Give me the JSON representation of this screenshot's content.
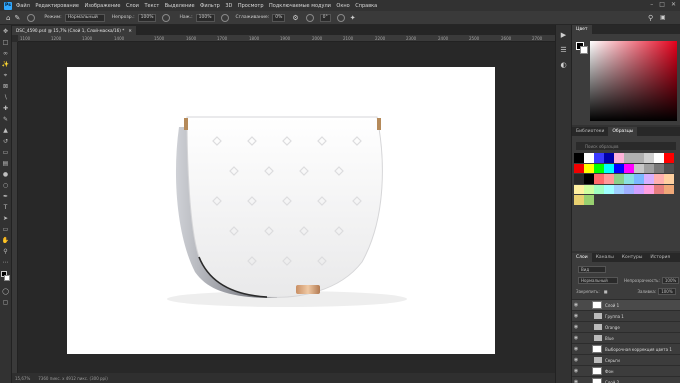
{
  "app": {
    "logo": "Ps"
  },
  "menu": [
    "Файл",
    "Редактирование",
    "Изображение",
    "Слои",
    "Текст",
    "Выделение",
    "Фильтр",
    "3D",
    "Просмотр",
    "Подключаемые модули",
    "Окно",
    "Справка"
  ],
  "options": {
    "mode_label": "Режим:",
    "mode_value": "Нормальный",
    "opacity_label": "Непрозр.:",
    "opacity_value": "100%",
    "flow_label": "Наж.:",
    "flow_value": "100%",
    "smooth_label": "Сглаживание:",
    "smooth_value": "0%",
    "angle_value": "0°"
  },
  "document": {
    "tab_title": "DSC_4590.psd @ 15,7% (Слой 1, Слой-маска/16) *"
  },
  "rulers": {
    "top": [
      "1100",
      "1200",
      "1300",
      "1400",
      "1500",
      "1600",
      "1700",
      "1800",
      "1900",
      "2000",
      "2100",
      "2200",
      "2300",
      "2400",
      "2500",
      "2600",
      "2700"
    ]
  },
  "status": {
    "zoom": "15,67%",
    "size": "7360 пикс. x 4912 пикс. (300 ppi)"
  },
  "color_panel": {
    "tabs": [
      "Цвет"
    ],
    "fg_color": "#000000",
    "bg_color": "#ffffff",
    "hue": "#e4001b"
  },
  "swatches_panel": {
    "tabs": [
      "Библиотеки",
      "Образцы"
    ],
    "search_placeholder": "Поиск образцов",
    "colors": [
      "#000000",
      "#ffffff",
      "#3a3aff",
      "#0000aa",
      "#ffb3d9",
      "#b0b0b0",
      "#b0b0b0",
      "#d0d0d0",
      "#ffffff",
      "#ff0000",
      "#f20000",
      "#ffff00",
      "#00ff00",
      "#00ffff",
      "#0000ff",
      "#ff00ff",
      "#c8c8c8",
      "#a0a0a0",
      "#787878",
      "#505050",
      "#282828",
      "#000000",
      "#ff6a6a",
      "#ff9a9a",
      "#8ad08a",
      "#8ae0e0",
      "#7ab8ff",
      "#d8b0ff",
      "#ffb0b0",
      "#ffd0a0",
      "#fff0a0",
      "#d0ffa0",
      "#a0ffc0",
      "#a0ffff",
      "#a0d0ff",
      "#a0b0ff",
      "#d0a0ff",
      "#ffa0e0",
      "#e67e7e",
      "#f0a878",
      "#e8d070",
      "#98d070"
    ]
  },
  "layers_panel": {
    "tabs": [
      "Слои",
      "Каналы",
      "Контуры",
      "История"
    ],
    "kind_label": "Вид",
    "blend": "Нормальный",
    "opacity_label": "Непрозрачность:",
    "opacity_value": "100%",
    "lock_label": "Закрепить:",
    "fill_label": "Заливка:",
    "fill_value": "100%",
    "layers": [
      {
        "name": "Слой 1",
        "type": "layer",
        "selected": true
      },
      {
        "name": "Группа 1",
        "type": "group",
        "selected": false
      },
      {
        "name": "Orange",
        "type": "group",
        "selected": false
      },
      {
        "name": "Blue",
        "type": "group",
        "selected": false
      },
      {
        "name": "Выборочная коррекция цвета 1",
        "type": "adjust",
        "selected": false
      },
      {
        "name": "Серьги",
        "type": "group",
        "selected": false
      },
      {
        "name": "Фон",
        "type": "layer",
        "selected": false
      },
      {
        "name": "Слой 2",
        "type": "layer",
        "selected": false
      },
      {
        "name": "Отражение сумки",
        "type": "layer",
        "selected": false
      }
    ]
  }
}
